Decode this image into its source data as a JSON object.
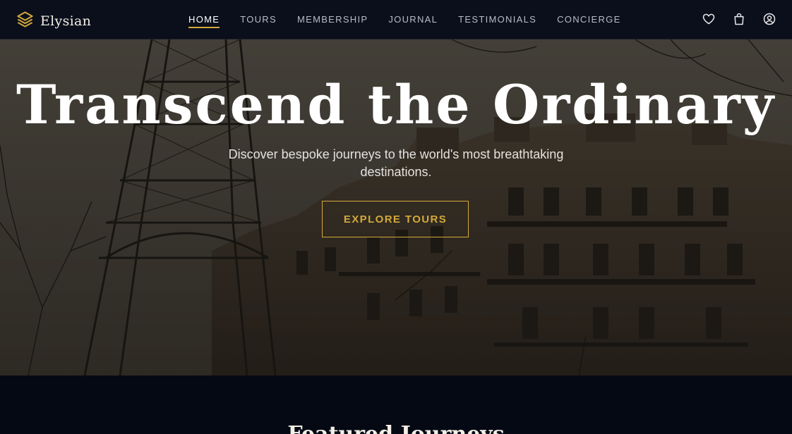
{
  "brand": {
    "name": "Elysian",
    "logo_icon": "layers-icon",
    "accent": "#d4a93a"
  },
  "nav": {
    "items": [
      {
        "label": "HOME",
        "active": true
      },
      {
        "label": "TOURS",
        "active": false
      },
      {
        "label": "MEMBERSHIP",
        "active": false
      },
      {
        "label": "JOURNAL",
        "active": false
      },
      {
        "label": "TESTIMONIALS",
        "active": false
      },
      {
        "label": "CONCIERGE",
        "active": false
      }
    ],
    "icons": [
      "heart-icon",
      "shopping-bag-icon",
      "user-circle-icon"
    ]
  },
  "hero": {
    "title": "Transcend the Ordinary",
    "subtitle": "Discover bespoke journeys to the world's most breathtaking destinations.",
    "cta_label": "EXPLORE TOURS"
  },
  "featured": {
    "title": "Featured Journeys"
  },
  "colors": {
    "nav_bg": "#0b0f1c",
    "page_bg": "#050914",
    "gold": "#d4a93a"
  }
}
